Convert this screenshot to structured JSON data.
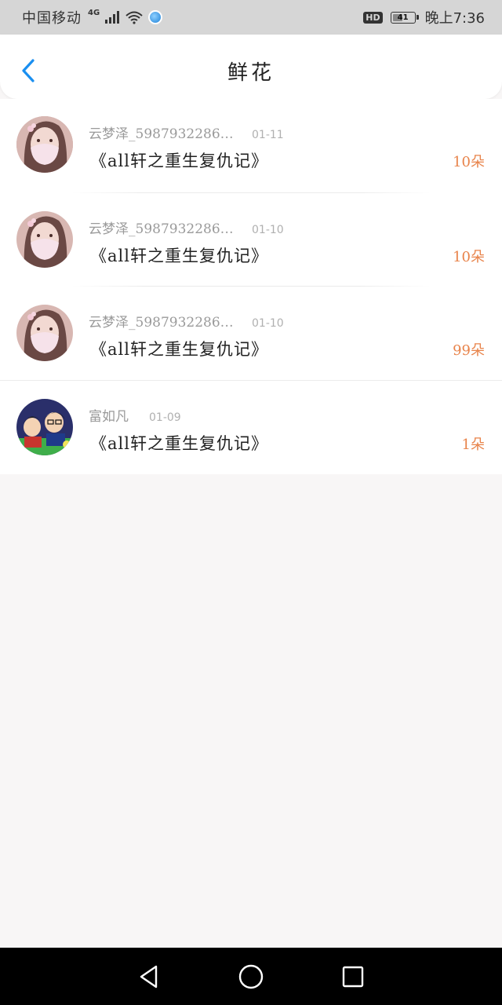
{
  "status_bar": {
    "carrier": "中国移动",
    "network": "4G",
    "time": "晚上7:36",
    "hd": "HD",
    "battery": "41",
    "battery_level": 0.41
  },
  "header": {
    "title": "鲜花",
    "back_icon": "chevron-left-icon",
    "accent_color": "#1a8ff0"
  },
  "records": [
    {
      "user": "云梦泽_5987932286…",
      "date": "01-11",
      "book": "《all轩之重生复仇记》",
      "count": "10朵",
      "avatar": "girl-mask-avatar"
    },
    {
      "user": "云梦泽_5987932286…",
      "date": "01-10",
      "book": "《all轩之重生复仇记》",
      "count": "10朵",
      "avatar": "girl-mask-avatar"
    },
    {
      "user": "云梦泽_5987932286…",
      "date": "01-10",
      "book": "《all轩之重生复仇记》",
      "count": "99朵",
      "avatar": "girl-mask-avatar"
    },
    {
      "user": "富如凡",
      "date": "01-09",
      "book": "《all轩之重生复仇记》",
      "count": "1朵",
      "avatar": "anime-group-avatar"
    }
  ],
  "colors": {
    "count": "#e8834a",
    "background": "#f8f6f6"
  },
  "nav": {
    "back": "triangle-back-icon",
    "home": "circle-home-icon",
    "recent": "square-recent-icon"
  }
}
